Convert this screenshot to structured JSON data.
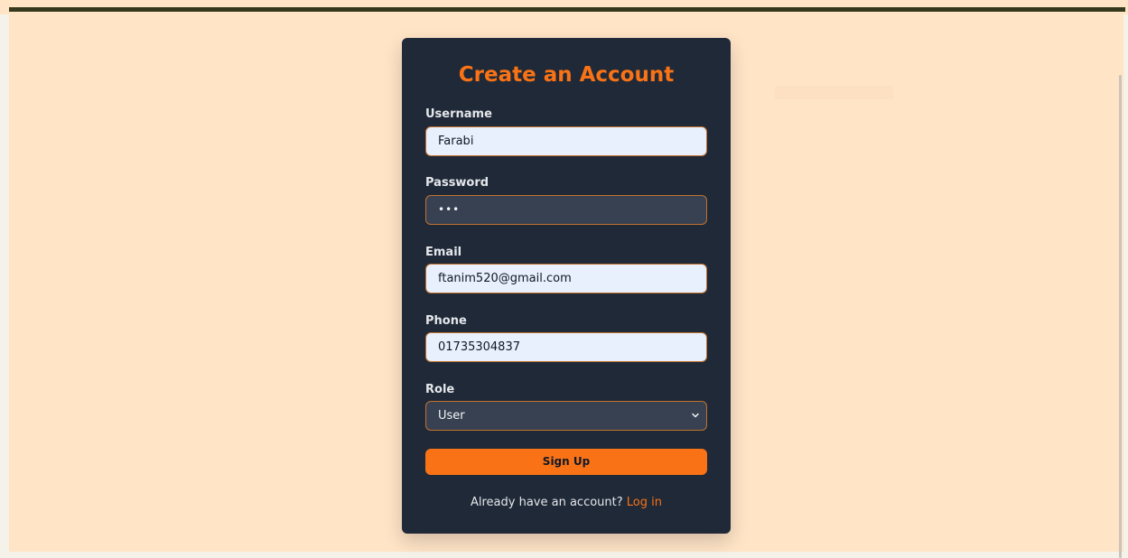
{
  "form": {
    "title": "Create an Account",
    "username": {
      "label": "Username",
      "value": "Farabi"
    },
    "password": {
      "label": "Password",
      "value": "•••"
    },
    "email": {
      "label": "Email",
      "value": "ftanim520@gmail.com"
    },
    "phone": {
      "label": "Phone",
      "value": "01735304837"
    },
    "role": {
      "label": "Role",
      "value": "User"
    },
    "submit_label": "Sign Up",
    "footer_text": "Already have an account?",
    "login_label": "Log in"
  },
  "colors": {
    "accent": "#f97316",
    "card_bg": "#1f2937",
    "page_bg": "#ffe4c6"
  },
  "icons": {
    "role_dropdown": "chevron-down-icon"
  }
}
